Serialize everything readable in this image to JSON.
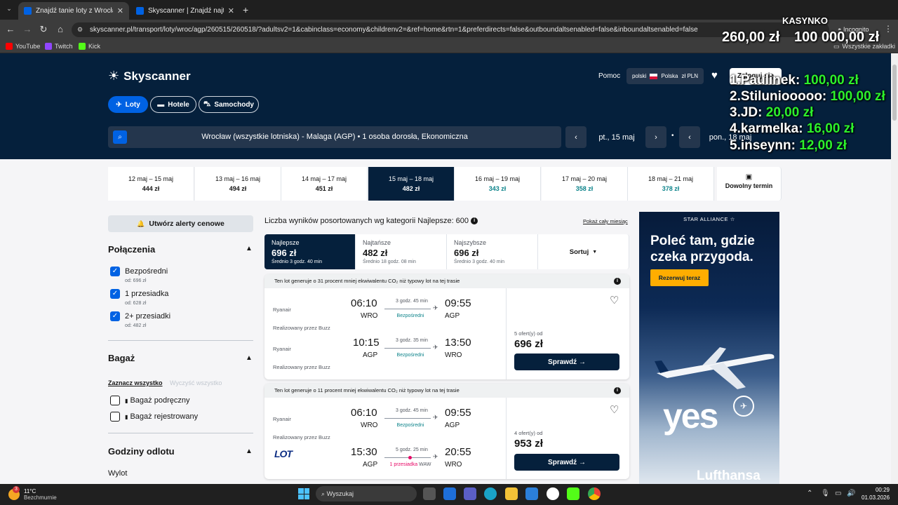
{
  "browser": {
    "tabs": [
      {
        "title": "Znajdź tanie loty z Wrocław do"
      },
      {
        "title": "Skyscanner | Znajdź najtańsze l"
      }
    ],
    "url": "skyscanner.pl/transport/loty/wroc/agp/260515/260518/?adultsv2=1&cabinclass=economy&childrenv2=&ref=home&rtn=1&preferdirects=false&outboundaltsenabled=false&inboundaltsenabled=false",
    "incognito": "Incognito",
    "bookmarks": [
      "YouTube",
      "Twitch",
      "Kick"
    ],
    "all_bookmarks": "Wszystkie zakładki"
  },
  "header": {
    "logo": "Skyscanner",
    "help": "Pomoc",
    "locale_lang": "polski",
    "locale_country": "Polska",
    "locale_currency": "zł PLN",
    "login": "Zaloguj się"
  },
  "nav": {
    "flights": "Loty",
    "hotels": "Hotele",
    "cars": "Samochody"
  },
  "search": {
    "summary": "Wrocław (wszystkie lotniska) - Malaga (AGP)  •  1 osoba dorosła, Ekonomiczna",
    "depart": "pt., 15 maj",
    "return": "pon., 18 maj"
  },
  "dates": [
    {
      "range": "12 maj – 15 maj",
      "price": "444 zł",
      "green": false
    },
    {
      "range": "13 maj – 16 maj",
      "price": "494 zł",
      "green": false
    },
    {
      "range": "14 maj – 17 maj",
      "price": "451 zł",
      "green": false
    },
    {
      "range": "15 maj – 18 maj",
      "price": "482 zł",
      "green": false
    },
    {
      "range": "16 maj – 19 maj",
      "price": "343 zł",
      "green": true
    },
    {
      "range": "17 maj – 20 maj",
      "price": "358 zł",
      "green": true
    },
    {
      "range": "18 maj – 21 maj",
      "price": "378 zł",
      "green": true
    }
  ],
  "any_date": "Dowolny termin",
  "filters": {
    "alert": "Utwórz alerty cenowe",
    "connections_title": "Połączenia",
    "connections": [
      {
        "label": "Bezpośredni",
        "sub": "od: 696 zł"
      },
      {
        "label": "1 przesiadka",
        "sub": "od: 628 zł"
      },
      {
        "label": "2+ przesiadki",
        "sub": "od: 482 zł"
      }
    ],
    "baggage_title": "Bagaż",
    "select_all": "Zaznacz wszystko",
    "clear_all": "Wyczyść wszystko",
    "baggage": [
      "Bagaż podręczny",
      "Bagaż rejestrowany"
    ],
    "times_title": "Godziny odlotu",
    "departure": "Wylot"
  },
  "results": {
    "count_text": "Liczba wyników posortowanych wg kategorii Najlepsze: 600",
    "show_month": "Pokaż cały miesiąc",
    "sort_tabs": [
      {
        "name": "Najlepsze",
        "price": "696 zł",
        "avg": "Średnio 3 godz. 40 min"
      },
      {
        "name": "Najtańsze",
        "price": "482 zł",
        "avg": "Średnio 18 godz. 08 min"
      },
      {
        "name": "Najszybsze",
        "price": "696 zł",
        "avg": "Średnio 3 godz. 40 min"
      }
    ],
    "sort_label": "Sortuj",
    "cards": [
      {
        "eco": "Ten lot generuje o 31 procent mniej ekwiwalentu CO₂ niż typowy lot na tej trasie",
        "legs": [
          {
            "airline": "Ryanair",
            "dep": "06:10",
            "from": "WRO",
            "dur": "3 godz. 45 min",
            "stop": "Bezpośredni",
            "arr": "09:55",
            "to": "AGP",
            "oper": "Realizowany przez Buzz"
          },
          {
            "airline": "Ryanair",
            "dep": "10:15",
            "from": "AGP",
            "dur": "3 godz. 35 min",
            "stop": "Bezpośredni",
            "arr": "13:50",
            "to": "WRO",
            "oper": "Realizowany przez Buzz"
          }
        ],
        "offers": "5 ofert(y) od",
        "price": "696 zł",
        "cta": "Sprawdź"
      },
      {
        "eco": "Ten lot generuje o 11 procent mniej ekwiwalentu CO₂ niż typowy lot na tej trasie",
        "legs": [
          {
            "airline": "Ryanair",
            "dep": "06:10",
            "from": "WRO",
            "dur": "3 godz. 45 min",
            "stop": "Bezpośredni",
            "arr": "09:55",
            "to": "AGP",
            "oper": "Realizowany przez Buzz"
          },
          {
            "airline": "LOT",
            "dep": "15:30",
            "from": "AGP",
            "dur": "5 godz. 25 min",
            "stop": "1 przesiadka",
            "stop_via": "WAW",
            "arr": "20:55",
            "to": "WRO",
            "oper": ""
          }
        ],
        "offers": "4 ofert(y) od",
        "price": "953 zł",
        "cta": "Sprawdź"
      }
    ]
  },
  "ad": {
    "alliance": "STAR ALLIANCE",
    "headline": "Poleć tam, gdzie czeka przygoda.",
    "cta": "Rezerwuj teraz",
    "slogan": "yes",
    "brand": "Lufthansa"
  },
  "overlay": {
    "title": "KASYNKO",
    "balance_left": "260,00 zł",
    "balance_right": "100 000,00 zł",
    "leaders": [
      {
        "name": "1.Paulinek:",
        "amount": "100,00 zł"
      },
      {
        "name": "2.Stiluniooooo:",
        "amount": "100,00 zł"
      },
      {
        "name": "3.JD:",
        "amount": "20,00 zł"
      },
      {
        "name": "4.karmelka:",
        "amount": "16,00 zł"
      },
      {
        "name": "5.inseynn:",
        "amount": "12,00 zł"
      }
    ]
  },
  "taskbar": {
    "weather_temp": "11°C",
    "weather_desc": "Bezchmurnie",
    "weather_badge": "3",
    "search": "Wyszukaj",
    "time": "00:29",
    "date": "01.03.2026"
  }
}
